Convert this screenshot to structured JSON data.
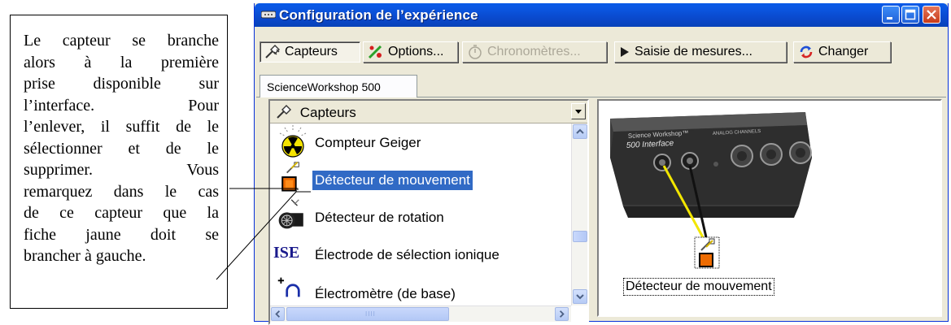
{
  "note": {
    "lines": [
      "Le capteur se branche",
      "alors   à la première",
      "prise disponible sur",
      "l’interface.     Pour",
      "l’enlever, il suffit de le",
      "sélectionner et de le",
      "supprimer.       Vous",
      "remarquez dans le cas",
      "de ce capteur que la",
      "fiche jaune doit se",
      "brancher à gauche."
    ]
  },
  "window": {
    "title": "Configuration de l’expérience",
    "controls": {
      "minimize_icon": "minimize-icon",
      "maximize_icon": "maximize-icon",
      "close_icon": "close-icon"
    }
  },
  "toolbar": {
    "capteurs_label": "Capteurs",
    "options_label": "Options...",
    "chronometres_label": "Chronomètres...",
    "saisie_label": "Saisie de mesures...",
    "changer_label": "Changer"
  },
  "tab": {
    "label": "ScienceWorkshop 500"
  },
  "sensor_list": {
    "header": "Capteurs",
    "items": [
      {
        "label": "Compteur Geiger",
        "icon": "radiation-icon",
        "selected": false
      },
      {
        "label": "Détecteur de mouvement",
        "icon": "motion-sensor-icon",
        "selected": true
      },
      {
        "label": "Détecteur de rotation",
        "icon": "rotary-sensor-icon",
        "selected": false
      },
      {
        "label": "Électrode de sélection ionique",
        "icon": "ise-icon",
        "icon_text": "ISE",
        "selected": false
      },
      {
        "label": "Électromètre (de base)",
        "icon": "electrometer-icon",
        "selected": false
      }
    ],
    "scrollbar_grip": "IIII"
  },
  "device": {
    "brand": "Science Workshop™",
    "model": "500 Interface",
    "analog_label": "ANALOG CHANNELS",
    "connected_sensor_label": "Détecteur de mouvement",
    "colors": {
      "yellow_plug": "#f2e600",
      "black_plug": "#111111"
    }
  }
}
